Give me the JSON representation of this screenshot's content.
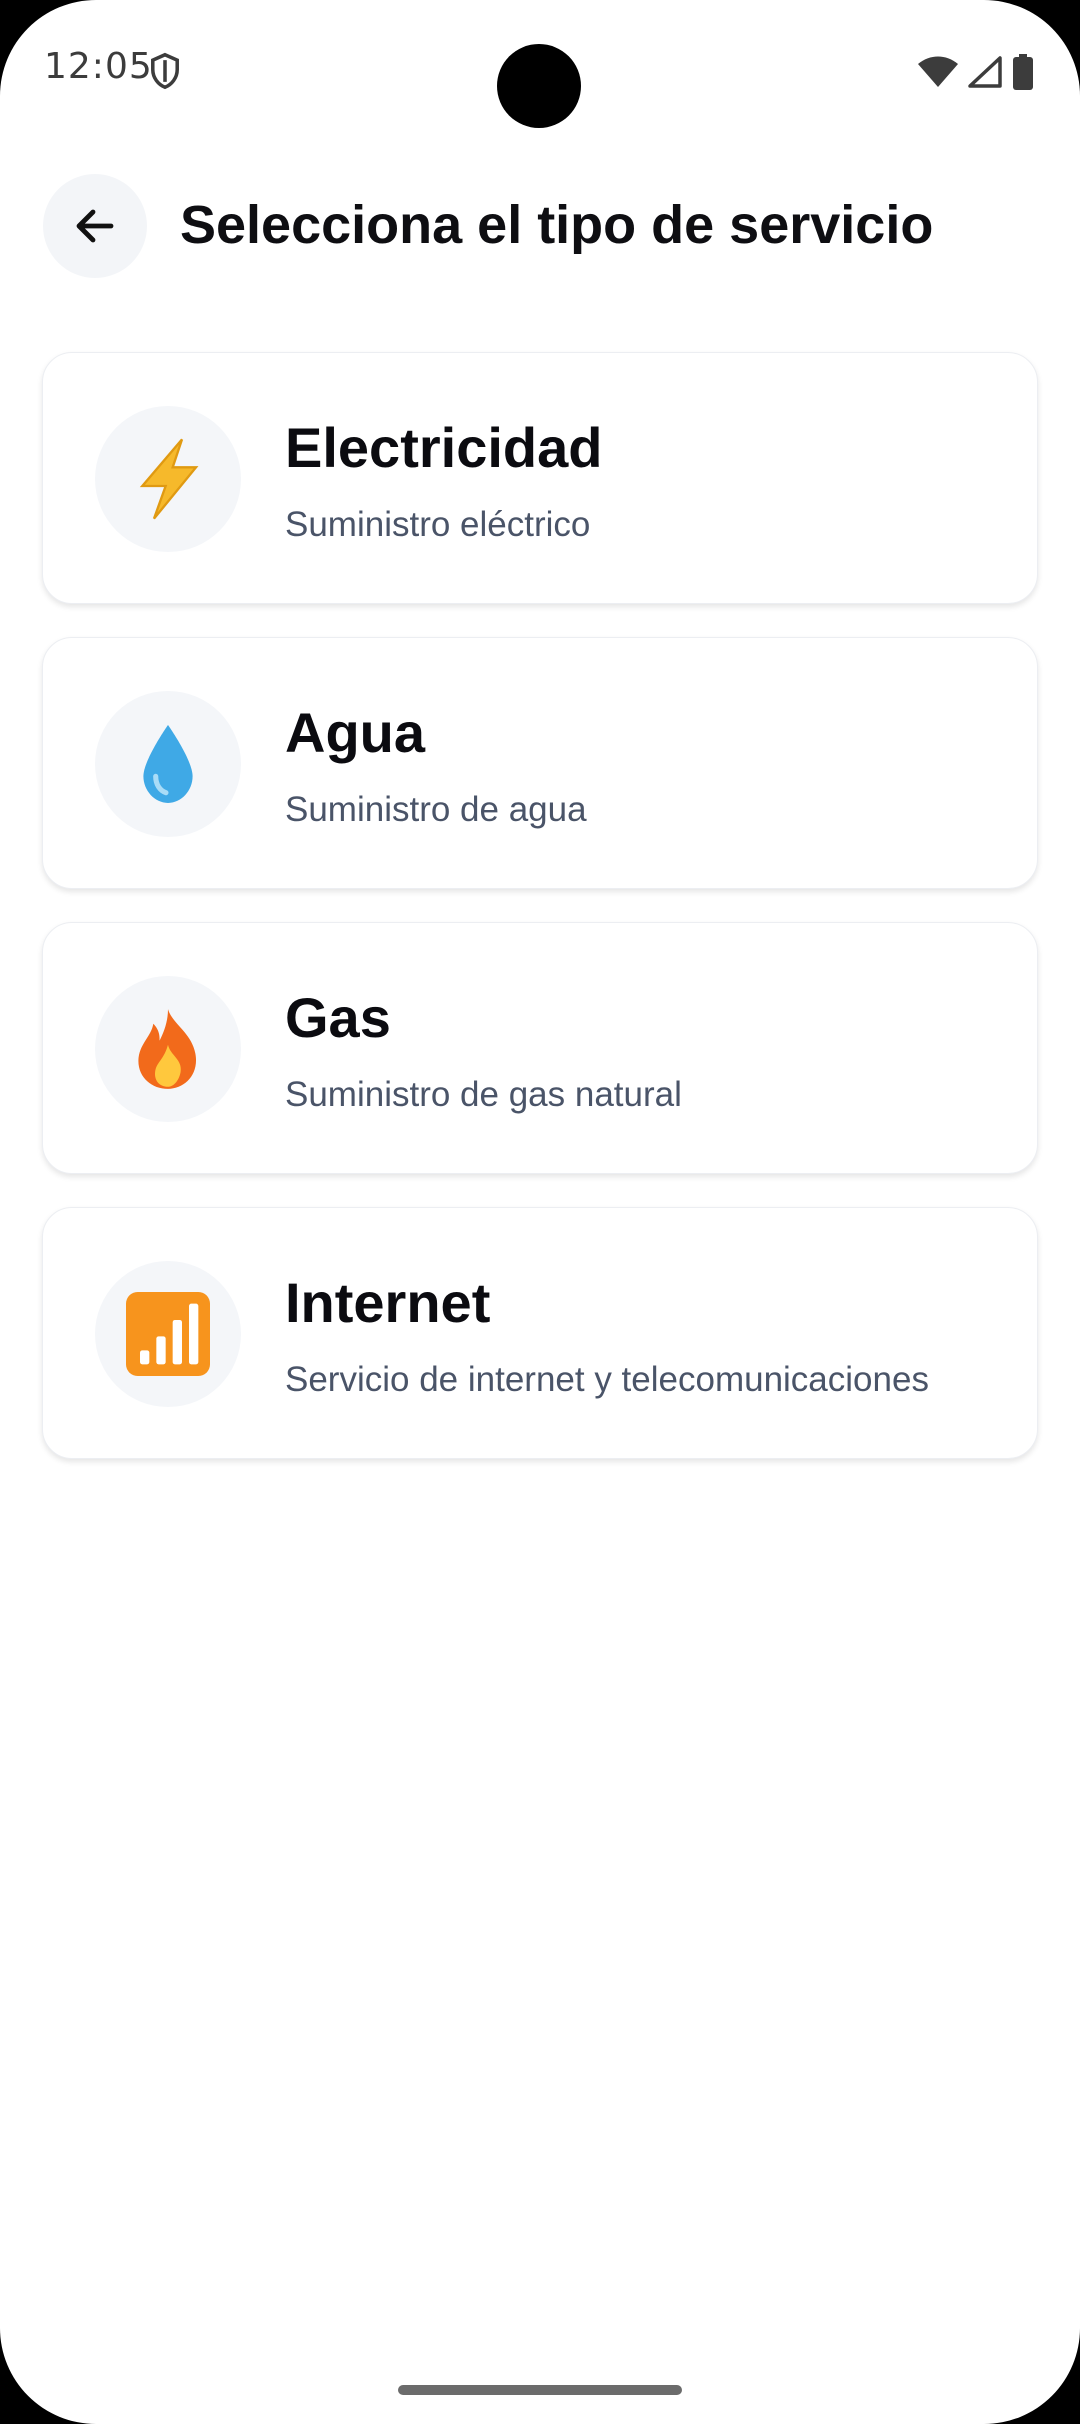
{
  "status_bar": {
    "time": "12:05",
    "icons": [
      "shield-icon",
      "wifi-icon",
      "cell-signal-icon",
      "battery-icon"
    ]
  },
  "header": {
    "back_icon": "arrow-left-icon",
    "title": "Selecciona el tipo de servicio"
  },
  "services": [
    {
      "name": "Electricidad",
      "description": "Suministro eléctrico",
      "icon": "lightning-icon",
      "accent": "#f6b92b"
    },
    {
      "name": "Agua",
      "description": "Suministro de agua",
      "icon": "water-drop-icon",
      "accent": "#3fa9e6"
    },
    {
      "name": "Gas",
      "description": "Suministro de gas natural",
      "icon": "fire-icon",
      "accent": "#f26a1b"
    },
    {
      "name": "Internet",
      "description": "Servicio de internet y telecomunicaciones",
      "icon": "signal-bars-icon",
      "accent": "#f7941d"
    }
  ]
}
